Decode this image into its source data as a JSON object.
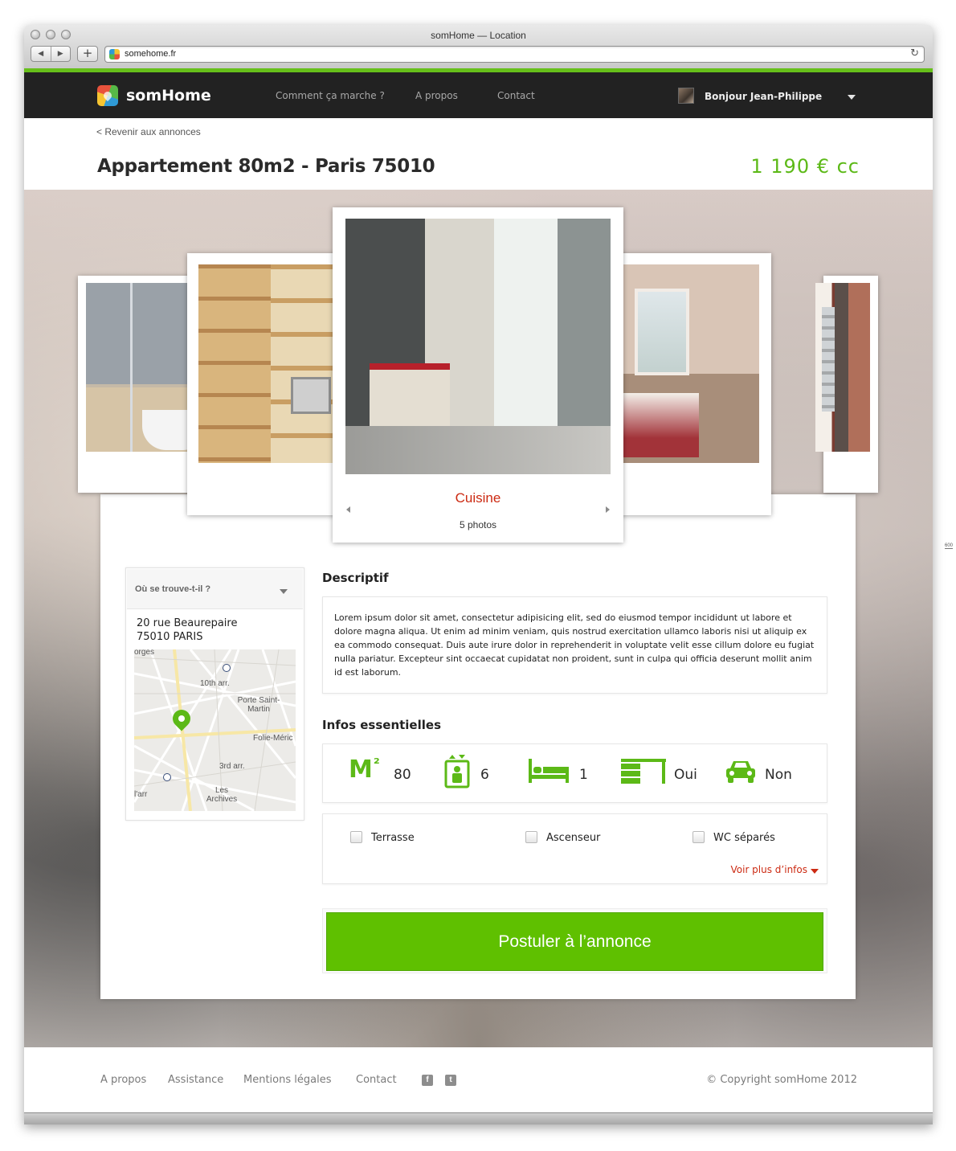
{
  "window": {
    "title": "somHome — Location",
    "url": "somehome.fr"
  },
  "header": {
    "brand": "somHome",
    "nav": [
      "Comment ça marche ?",
      "A propos",
      "Contact"
    ],
    "greeting": "Bonjour Jean-Philippe"
  },
  "listing": {
    "back_link": "< Revenir aux annonces",
    "title": "Appartement 80m2 - Paris 75010",
    "price": "1 190 € cc"
  },
  "gallery": {
    "current_title": "Cuisine",
    "current_count": "5 photos",
    "photos": [
      "bathroom",
      "living-room",
      "kitchen",
      "bedroom",
      "entrance"
    ]
  },
  "location": {
    "header": "Où se trouve-t-il ?",
    "address_line1": "20 rue Beaurepaire",
    "address_line2": "75010 PARIS",
    "map_labels": [
      "10th arr.",
      "Porte Saint-Martin",
      "Folie-Méric",
      "3rd arr.",
      "Les Archives",
      "l'arr",
      "orges"
    ]
  },
  "description": {
    "heading": "Descriptif",
    "text": "Lorem ipsum dolor sit amet, consectetur adipisicing elit, sed do eiusmod tempor incididunt ut labore et dolore magna aliqua. Ut enim ad minim veniam, quis nostrud exercitation ullamco laboris nisi ut aliquip ex ea commodo consequat. Duis aute irure dolor in reprehenderit in voluptate velit esse cillum dolore eu fugiat nulla pariatur. Excepteur sint occaecat cupidatat non proident, sunt in culpa qui officia deserunt mollit anim id est laborum."
  },
  "infos": {
    "heading": "Infos essentielles",
    "m2_symbol": "M²",
    "surface": "80",
    "rooms": "6",
    "beds": "1",
    "furnished": "Oui",
    "parking": "Non",
    "icons": [
      "m2-icon",
      "rooms-icon",
      "bed-icon",
      "desk-icon",
      "car-icon"
    ],
    "options": [
      "Terrasse",
      "Ascenseur",
      "WC séparés"
    ],
    "more_link": "Voir plus d’infos"
  },
  "cta": {
    "label": "Postuler à l’annonce"
  },
  "footer": {
    "links": [
      "A propos",
      "Assistance",
      "Mentions légales",
      "Contact"
    ],
    "copyright": "© Copyright somHome 2012",
    "social": [
      "f",
      "t"
    ]
  },
  "side_note": "600",
  "colors": {
    "brand_green": "#5cb917",
    "accent_red": "#cc2a12",
    "header_dark": "#222222"
  }
}
